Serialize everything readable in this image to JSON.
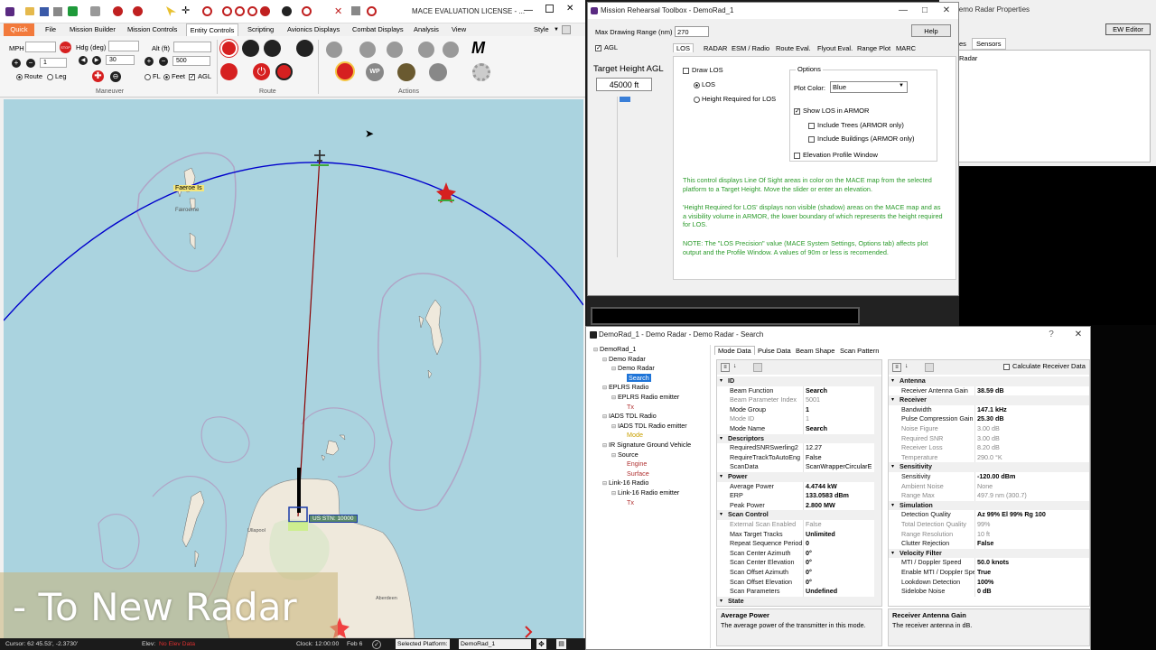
{
  "main_window": {
    "title": "MACE EVALUATION LICENSE - ...",
    "tabs": [
      "Quick",
      "File",
      "Mission Builder",
      "Mission Controls",
      "Entity Controls",
      "Scripting",
      "Avionics Displays",
      "Combat Displays",
      "Analysis",
      "View"
    ],
    "style_label": "Style",
    "maneuver": {
      "mph_label": "MPH",
      "hdg_label": "Hdg (deg)",
      "alt_label": "Alt (ft)",
      "stop_label": "STOP",
      "step_value": "1",
      "hdg_step": "30",
      "alt_step": "500",
      "route_label": "Route",
      "leg_label": "Leg",
      "fl_label": "FL",
      "feet_label": "Feet",
      "agl_label": "AGL",
      "group_label": "Maneuver"
    },
    "route_group_label": "Route",
    "actions_group_label": "Actions",
    "map": {
      "label_faeroe_is": "Faeroe Is",
      "label_faroer": "Færoerne",
      "label_aberdeen": "Aberdeen",
      "label_ullapool": "Ullapool",
      "platform_label": "US STN: 10000"
    },
    "banner_text": "- To New Radar",
    "statusbar": {
      "cursor": "Cursor: 62 45.53', -2.3730'",
      "elev_label": "Elev:",
      "elev_value": "No Elev Data",
      "clock": "Clock: 12:00:00",
      "date": "Feb 6",
      "platform_label": "Selected Platform:",
      "platform_value": "DemoRad_1"
    }
  },
  "toolbox": {
    "title": "Mission Rehearsal Toolbox - DemoRad_1",
    "max_range_label": "Max Drawing Range (nm)",
    "max_range_value": "270",
    "help_label": "Help",
    "agl_label": "AGL",
    "target_height_label": "Target Height AGL",
    "target_height_value": "45000 ft",
    "tabs": [
      "LOS",
      "RADAR",
      "ESM / Radio",
      "Route Eval.",
      "Flyout Eval.",
      "Range Plot",
      "MARC"
    ],
    "draw_los_label": "Draw LOS",
    "los_label": "LOS",
    "height_required_label": "Height Required for LOS",
    "options_label": "Options",
    "plot_color_label": "Plot Color:",
    "plot_color_value": "Blue",
    "show_los_label": "Show LOS in ARMOR",
    "include_trees_label": "Include Trees (ARMOR only)",
    "include_buildings_label": "Include Buildings (ARMOR only)",
    "elevation_profile_label": "Elevation Profile Window",
    "help_text_1": "This control displays Line Of Sight areas in color on the MACE map from the selected platform to a Target Height.  Move the slider or enter an elevation.",
    "help_text_2": "'Height Required for LOS' displays non visible (shadow) areas on the MACE map and as a visibility volume in ARMOR, the lower boundary of which represents the height required for LOS.",
    "help_text_3": "NOTE: The \"LOS Precision\" value (MACE System Settings, Options tab) affects plot output and the Profile Window. A values of 90m or less is recomended."
  },
  "back_window": {
    "title": "Demo Radar Properties",
    "tab1": "es",
    "tab2": "Sensors",
    "item": "Radar",
    "ew_editor": "EW Editor"
  },
  "radar_window": {
    "title": "DemoRad_1 - Demo Radar - Demo Radar - Search",
    "tree": [
      {
        "label": "DemoRad_1",
        "indent": 0,
        "color": "#000"
      },
      {
        "label": "Demo Radar",
        "indent": 1,
        "color": "#000"
      },
      {
        "label": "Demo Radar",
        "indent": 2,
        "color": "#000"
      },
      {
        "label": "Search",
        "indent": 3,
        "color": "#fff",
        "selected": true
      },
      {
        "label": "EPLRS Radio",
        "indent": 1,
        "color": "#000"
      },
      {
        "label": "EPLRS Radio emitter",
        "indent": 2,
        "color": "#000"
      },
      {
        "label": "Tx",
        "indent": 3,
        "color": "#b03030"
      },
      {
        "label": "IADS TDL Radio",
        "indent": 1,
        "color": "#000"
      },
      {
        "label": "IADS TDL Radio emitter",
        "indent": 2,
        "color": "#000"
      },
      {
        "label": "Mode",
        "indent": 3,
        "color": "#c8a000"
      },
      {
        "label": "IR Signature Ground Vehicle",
        "indent": 1,
        "color": "#000"
      },
      {
        "label": "Source",
        "indent": 2,
        "color": "#000"
      },
      {
        "label": "Engine",
        "indent": 3,
        "color": "#b03030"
      },
      {
        "label": "Surface",
        "indent": 3,
        "color": "#b03030"
      },
      {
        "label": "Link-16 Radio",
        "indent": 1,
        "color": "#000"
      },
      {
        "label": "Link-16 Radio emitter",
        "indent": 2,
        "color": "#000"
      },
      {
        "label": "Tx",
        "indent": 3,
        "color": "#b03030"
      }
    ],
    "tabs": [
      "Mode Data",
      "Pulse Data",
      "Beam Shape",
      "Scan Pattern"
    ],
    "calc_gain_label": "Calculate Receiver Data",
    "left_props": [
      {
        "k": "ID",
        "hdr": true
      },
      {
        "k": "Beam Function",
        "v": "Search"
      },
      {
        "k": "Beam Parameter Index",
        "v": "5001",
        "dim": true
      },
      {
        "k": "Mode Group",
        "v": "1"
      },
      {
        "k": "Mode ID",
        "v": "1",
        "dim": true
      },
      {
        "k": "Mode Name",
        "v": "Search"
      },
      {
        "k": "Descriptors",
        "hdr": true
      },
      {
        "k": "RequiredSNRSwerling2",
        "v": "12.27",
        "plain": true
      },
      {
        "k": "RequireTrackToAutoEng",
        "v": "False",
        "plain": true
      },
      {
        "k": "ScanData",
        "v": "ScanWrapperCircularE",
        "plain": true
      },
      {
        "k": "Power",
        "hdr": true
      },
      {
        "k": "Average Power",
        "v": "4.4744 kW"
      },
      {
        "k": "ERP",
        "v": "133.0583 dBm"
      },
      {
        "k": "Peak Power",
        "v": "2.800 MW"
      },
      {
        "k": "Scan Control",
        "hdr": true
      },
      {
        "k": "External Scan Enabled",
        "v": "False",
        "dim": true
      },
      {
        "k": "Max Target Tracks",
        "v": "Unlimited"
      },
      {
        "k": "Repeat Sequence Period",
        "v": "0"
      },
      {
        "k": "Scan Center Azimuth",
        "v": "0°"
      },
      {
        "k": "Scan Center Elevation",
        "v": "0°"
      },
      {
        "k": "Scan Offset Azimuth",
        "v": "0°"
      },
      {
        "k": "Scan Offset Elevation",
        "v": "0°"
      },
      {
        "k": "Scan Parameters",
        "v": "Undefined"
      },
      {
        "k": "State",
        "hdr": true
      }
    ],
    "right_props": [
      {
        "k": "Antenna",
        "hdr": true
      },
      {
        "k": "Receiver Antenna Gain",
        "v": "38.59 dB"
      },
      {
        "k": "Receiver",
        "hdr": true
      },
      {
        "k": "Bandwidth",
        "v": "147.1 kHz"
      },
      {
        "k": "Pulse Compression Gain",
        "v": "25.30 dB"
      },
      {
        "k": "Noise Figure",
        "v": "3.00 dB",
        "dim": true
      },
      {
        "k": "Required SNR",
        "v": "3.00 dB",
        "dim": true
      },
      {
        "k": "Receiver Loss",
        "v": "8.20 dB",
        "dim": true
      },
      {
        "k": "Temperature",
        "v": "290.0 °K",
        "dim": true
      },
      {
        "k": "Sensitivity",
        "hdr": true
      },
      {
        "k": "Sensitivity",
        "v": "-120.00 dBm"
      },
      {
        "k": "Ambient Noise",
        "v": "None",
        "dim": true
      },
      {
        "k": "Range Max",
        "v": "497.9 nm (300.7)",
        "dim": true
      },
      {
        "k": "Simulation",
        "hdr": true
      },
      {
        "k": "Detection Quality",
        "v": "Az 99%  El 99%  Rg 100"
      },
      {
        "k": "Total Detection Quality",
        "v": "99%",
        "dim": true
      },
      {
        "k": "Range Resolution",
        "v": "10 ft",
        "dim": true
      },
      {
        "k": "Clutter Rejection",
        "v": "False"
      },
      {
        "k": "Velocity Filter",
        "hdr": true
      },
      {
        "k": "MTI / Doppler Speed",
        "v": "50.0 knots"
      },
      {
        "k": "Enable MTI / Doppler Speed",
        "v": "True"
      },
      {
        "k": "Lookdown Detection",
        "v": "100%"
      },
      {
        "k": "Sidelobe Noise",
        "v": "0 dB"
      }
    ],
    "left_desc_title": "Average Power",
    "left_desc_text": "The average power of the transmitter in this mode.",
    "right_desc_title": "Receiver Antenna Gain",
    "right_desc_text": "The receiver antenna in dB."
  },
  "colors": {
    "los_arc": "#0000cc",
    "los_line": "#8b0000",
    "sea": "#aad3df",
    "land": "#efe9dc",
    "help_text": "#2a9a2a",
    "accent_red": "#d62020"
  }
}
